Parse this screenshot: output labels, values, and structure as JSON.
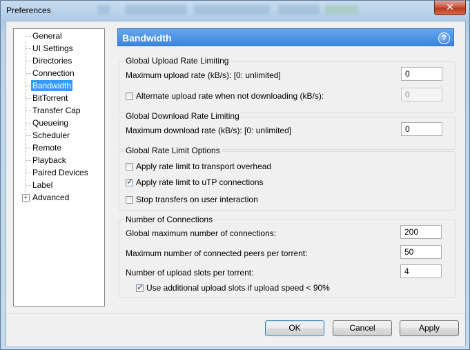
{
  "window": {
    "title": "Preferences",
    "close_glyph": "✕"
  },
  "tree": {
    "items": [
      {
        "label": "General",
        "selected": false
      },
      {
        "label": "UI Settings",
        "selected": false
      },
      {
        "label": "Directories",
        "selected": false
      },
      {
        "label": "Connection",
        "selected": false
      },
      {
        "label": "Bandwidth",
        "selected": true
      },
      {
        "label": "BitTorrent",
        "selected": false
      },
      {
        "label": "Transfer Cap",
        "selected": false
      },
      {
        "label": "Queueing",
        "selected": false
      },
      {
        "label": "Scheduler",
        "selected": false
      },
      {
        "label": "Remote",
        "selected": false
      },
      {
        "label": "Playback",
        "selected": false
      },
      {
        "label": "Paired Devices",
        "selected": false
      },
      {
        "label": "Label",
        "selected": false
      },
      {
        "label": "Advanced",
        "selected": false,
        "expandable": true,
        "expander_glyph": "+"
      }
    ]
  },
  "panel": {
    "title": "Bandwidth",
    "help_glyph": "?",
    "upload": {
      "group_title": "Global Upload Rate Limiting",
      "max_label": "Maximum upload rate (kB/s): [0: unlimited]",
      "max_value": "0",
      "alt_label": "Alternate upload rate when not downloading (kB/s):",
      "alt_checked": false,
      "alt_value": "0"
    },
    "download": {
      "group_title": "Global Download Rate Limiting",
      "max_label": "Maximum download rate (kB/s): [0: unlimited]",
      "max_value": "0"
    },
    "options": {
      "group_title": "Global Rate Limit Options",
      "transport_label": "Apply rate limit to transport overhead",
      "transport_checked": false,
      "utp_label": "Apply rate limit to uTP connections",
      "utp_checked": true,
      "stop_label": "Stop transfers on user interaction",
      "stop_checked": false
    },
    "connections": {
      "group_title": "Number of Connections",
      "global_label": "Global maximum number of connections:",
      "global_value": "200",
      "peers_label": "Maximum number of connected peers per torrent:",
      "peers_value": "50",
      "slots_label": "Number of upload slots per torrent:",
      "slots_value": "4",
      "additional_label": "Use additional upload slots if upload speed < 90%",
      "additional_checked": true
    }
  },
  "footer": {
    "ok": "OK",
    "cancel": "Cancel",
    "apply": "Apply"
  }
}
